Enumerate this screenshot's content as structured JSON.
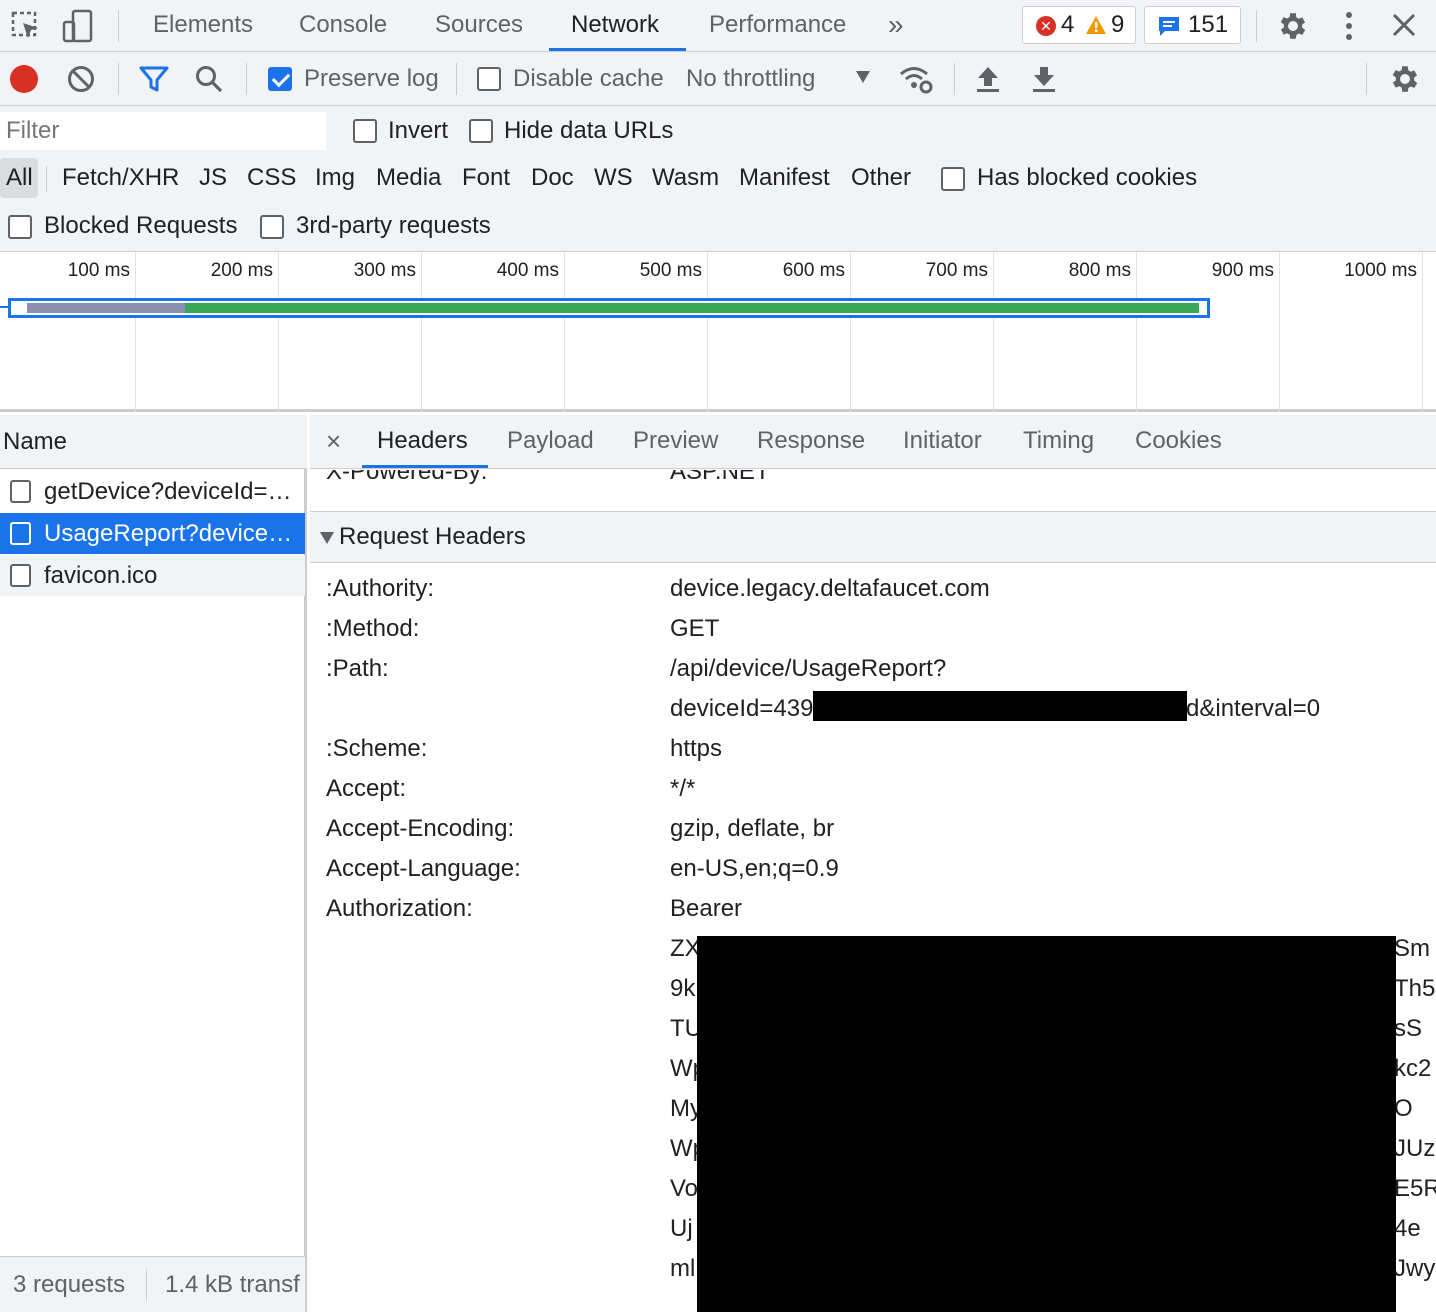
{
  "topbar": {
    "tabs": [
      "Elements",
      "Console",
      "Sources",
      "Network",
      "Performance"
    ],
    "active_tab": "Network",
    "more_label": "»",
    "errors": "4",
    "warnings": "9",
    "messages": "151"
  },
  "toolbar": {
    "preserve_log_label": "Preserve log",
    "preserve_log_checked": true,
    "disable_cache_label": "Disable cache",
    "throttling_value": "No throttling"
  },
  "filter": {
    "placeholder": "Filter",
    "invert_label": "Invert",
    "hide_data_urls_label": "Hide data URLs",
    "types": [
      "All",
      "Fetch/XHR",
      "JS",
      "CSS",
      "Img",
      "Media",
      "Font",
      "Doc",
      "WS",
      "Wasm",
      "Manifest",
      "Other"
    ],
    "active_type": "All",
    "has_blocked_cookies_label": "Has blocked cookies",
    "blocked_requests_label": "Blocked Requests",
    "third_party_label": "3rd-party requests"
  },
  "overview": {
    "ticks": [
      "100 ms",
      "200 ms",
      "300 ms",
      "400 ms",
      "500 ms",
      "600 ms",
      "700 ms",
      "800 ms",
      "900 ms",
      "1000 ms"
    ]
  },
  "requests": {
    "column_name": "Name",
    "rows": [
      {
        "name": "getDevice?deviceId=…",
        "selected": false
      },
      {
        "name": "UsageReport?device…",
        "selected": true
      },
      {
        "name": "favicon.ico",
        "selected": false
      }
    ],
    "count_label": "3 requests",
    "transfer_label": "1.4 kB transf"
  },
  "details": {
    "close_label": "×",
    "tabs": [
      "Headers",
      "Payload",
      "Preview",
      "Response",
      "Initiator",
      "Timing",
      "Cookies"
    ],
    "active_tab": "Headers",
    "partial_row": {
      "key": "X-Powered-By:",
      "value": "ASP.NET"
    },
    "section_title": "Request Headers",
    "headers": [
      {
        "key": ":Authority:",
        "value": "device.legacy.deltafaucet.com"
      },
      {
        "key": ":Method:",
        "value": "GET"
      },
      {
        "key": ":Path:",
        "value": "/api/device/UsageReport?"
      },
      {
        "key": "",
        "value": "deviceId=439",
        "value_tail": "d&interval=0"
      },
      {
        "key": ":Scheme:",
        "value": "https"
      },
      {
        "key": "Accept:",
        "value": "*/*"
      },
      {
        "key": "Accept-Encoding:",
        "value": "gzip, deflate, br"
      },
      {
        "key": "Accept-Language:",
        "value": "en-US,en;q=0.9"
      },
      {
        "key": "Authorization:",
        "value": "Bearer"
      }
    ],
    "token_lines": [
      {
        "head": "ZX",
        "tail": "Sm"
      },
      {
        "head": "9k",
        "tail": "Th5"
      },
      {
        "head": "TU",
        "tail": "sS"
      },
      {
        "head": "Wp",
        "tail": "kc2"
      },
      {
        "head": "My",
        "tail": "O"
      },
      {
        "head": "Wp",
        "tail": "JUz"
      },
      {
        "head": "Vo",
        "tail": "E5R"
      },
      {
        "head": "Uj",
        "tail": "4e"
      },
      {
        "head": "ml",
        "tail": "Jwy"
      }
    ]
  },
  "colors": {
    "accent": "#1a73e8",
    "record": "#d93025",
    "error": "#d93025",
    "warning": "#f29900",
    "bar_wait": "#8c8fb0",
    "bar_download": "#3aa757"
  }
}
